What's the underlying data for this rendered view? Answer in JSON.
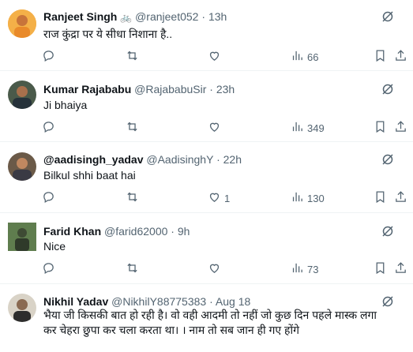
{
  "tweets": [
    {
      "name": "Ranjeet Singh",
      "emoji": "🚲",
      "handle": "@ranjeet052",
      "sep": "·",
      "time": "13h",
      "text": "राज कुंद्रा पर ये सीधा निशाना है..",
      "views": "66",
      "replies": "",
      "reposts": "",
      "likes": ""
    },
    {
      "name": "Kumar Rajababu",
      "handle": "@RajababuSir",
      "sep": "·",
      "time": "23h",
      "text": "Ji bhaiya",
      "views": "349",
      "replies": "",
      "reposts": "",
      "likes": ""
    },
    {
      "name": "@aadisingh_yadav",
      "handle": "@AadisinghY",
      "sep": "·",
      "time": "22h",
      "text": "Bilkul shhi baat hai",
      "views": "130",
      "replies": "",
      "reposts": "",
      "likes": "1"
    },
    {
      "name": "Farid Khan",
      "handle": "@farid62000",
      "sep": "·",
      "time": "9h",
      "text": "Nice",
      "views": "73",
      "replies": "",
      "reposts": "",
      "likes": ""
    },
    {
      "name": "Nikhil Yadav",
      "handle": "@NikhilY88775383",
      "sep": "·",
      "time": "Aug 18",
      "text": "भैया जी किसकी बात हो रही है। वो वही आदमी तो नहीं जो कुछ दिन पहले मास्क लगा कर चेहरा छुपा कर चला करता था। । नाम तो सब जान ही गए होंगे",
      "views": "",
      "replies": "",
      "reposts": "",
      "likes": ""
    }
  ],
  "colors": {
    "text": "#0f1419",
    "secondary": "#536471",
    "divider": "#eff3f4"
  },
  "icons": [
    "grok-icon",
    "reply-icon",
    "repost-icon",
    "like-icon",
    "views-icon",
    "bookmark-icon",
    "share-icon"
  ]
}
